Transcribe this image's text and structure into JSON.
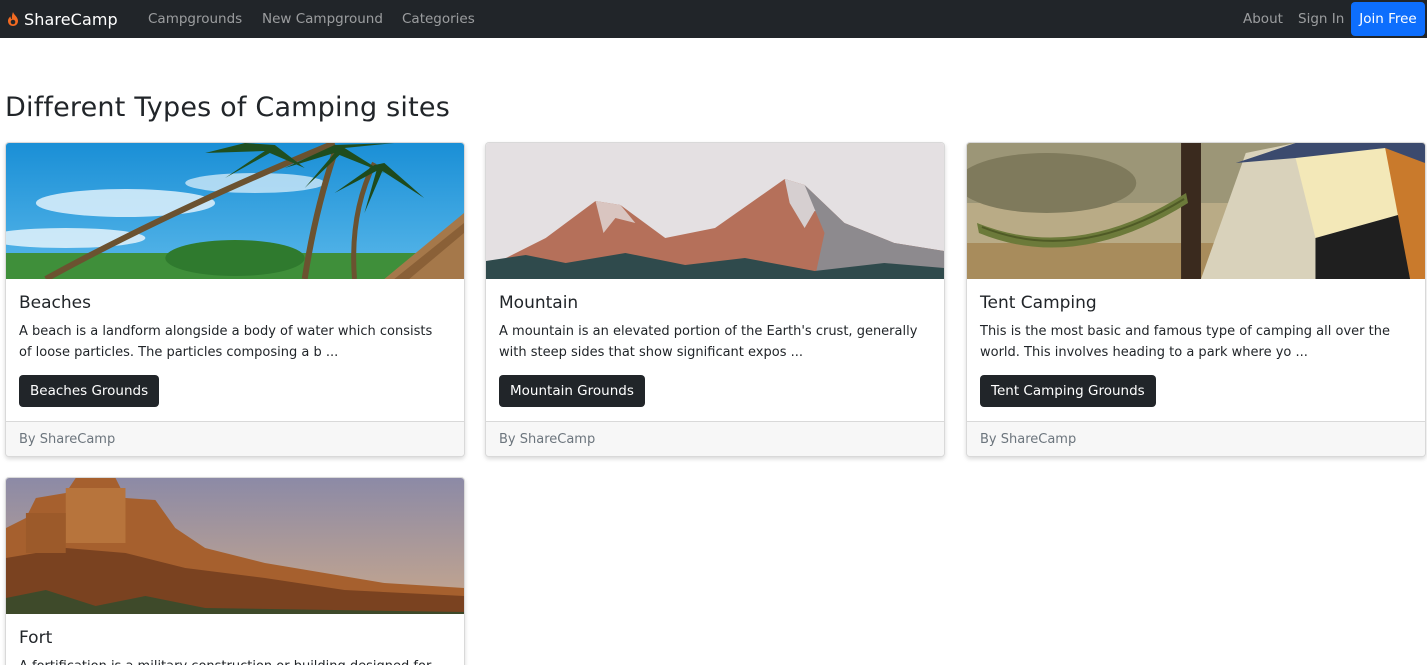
{
  "navbar": {
    "brand": "ShareCamp",
    "brand_icon": "flame-icon",
    "links": [
      "Campgrounds",
      "New Campground",
      "Categories"
    ],
    "right_links": [
      "About",
      "Sign In"
    ],
    "join_label": "Join Free",
    "colors": {
      "background": "#212529",
      "accent": "#0d6efd",
      "brand_icon": "#f26a21"
    }
  },
  "page": {
    "title": "Different Types of Camping sites"
  },
  "cards": [
    {
      "title": "Beaches",
      "text": "A beach is a landform alongside a body of water which consists of loose particles. The particles composing a b ...",
      "button": "Beaches Grounds",
      "footer": "By ShareCamp",
      "image": "beach-palm-trees-image"
    },
    {
      "title": "Mountain",
      "text": "A mountain is an elevated portion of the Earth's crust, generally with steep sides that show significant expos ...",
      "button": "Mountain Grounds",
      "footer": "By ShareCamp",
      "image": "mountain-peaks-image"
    },
    {
      "title": "Tent Camping",
      "text": "This is the most basic and famous type of camping all over the world. This involves heading to a park where yo ...",
      "button": "Tent Camping Grounds",
      "footer": "By ShareCamp",
      "image": "tent-hammock-image"
    },
    {
      "title": "Fort",
      "text": "A fortification is a military construction or building designed for",
      "button": "",
      "footer": "",
      "image": "fort-image"
    }
  ]
}
